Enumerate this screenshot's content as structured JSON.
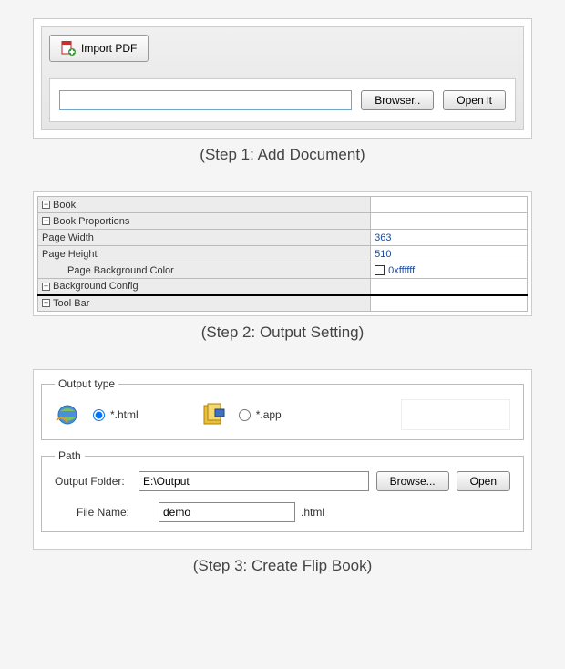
{
  "step1": {
    "import_label": "Import PDF",
    "path_value": "",
    "browser_label": "Browser..",
    "open_label": "Open it",
    "caption": "(Step 1: Add Document)"
  },
  "step2": {
    "tree": {
      "book": "Book",
      "proportions": "Book Proportions",
      "page_width_label": "Page Width",
      "page_width_value": "363",
      "page_height_label": "Page Height",
      "page_height_value": "510",
      "bg_color_label": "Page Background Color",
      "bg_color_value": "0xffffff",
      "bg_config": "Background Config",
      "toolbar": "Tool Bar"
    },
    "caption": "(Step 2: Output Setting)"
  },
  "step3": {
    "output_type_legend": "Output type",
    "opt_html": "*.html",
    "opt_app": "*.app",
    "path_legend": "Path",
    "output_folder_label": "Output Folder:",
    "output_folder_value": "E:\\Output",
    "browse_label": "Browse...",
    "open_label": "Open",
    "file_name_label": "File Name:",
    "file_name_value": "demo",
    "file_ext": ".html",
    "caption": "(Step 3: Create Flip Book)"
  }
}
